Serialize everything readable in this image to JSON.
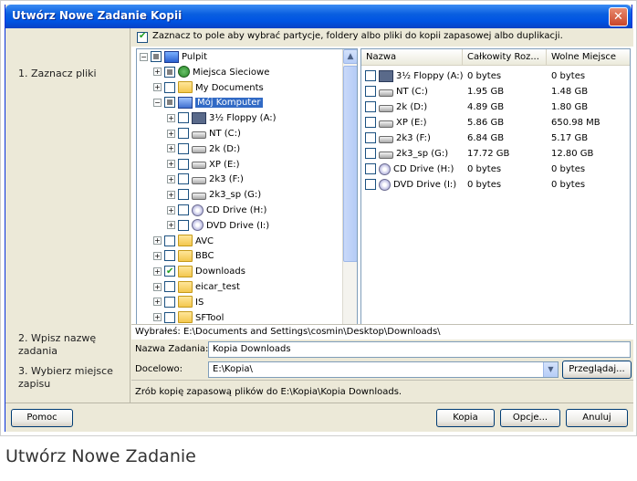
{
  "window": {
    "title": "Utwórz Nowe Zadanie Kopii",
    "close_glyph": "✕"
  },
  "steps": {
    "step1": "1. Zaznacz pliki",
    "step2_line1": "2. Wpisz nazwę",
    "step2_line2": "zadania",
    "step3_line1": "3. Wybierz miejsce",
    "step3_line2": "zapisu"
  },
  "top_checkbox": {
    "checked": true,
    "label": "Zaznacz to pole aby wybrać partycje, foldery albo pliki do kopii zapasowej albo duplikacji."
  },
  "tree": {
    "items": [
      {
        "label": "Pulpit",
        "icon": "desktop-icon",
        "expander": "−",
        "check": "partial"
      },
      {
        "label": "Miejsca Sieciowe",
        "icon": "network-icon",
        "expander": "+",
        "check": "partial"
      },
      {
        "label": "My Documents",
        "icon": "folder-icon",
        "expander": "+",
        "check": "none"
      },
      {
        "label": "Mój Komputer",
        "icon": "computer-icon",
        "expander": "−",
        "check": "partial",
        "selected": true
      },
      {
        "label": "3½ Floppy (A:)",
        "icon": "floppy-icon",
        "expander": "+",
        "check": "none"
      },
      {
        "label": "NT (C:)",
        "icon": "drive-icon",
        "expander": "+",
        "check": "none"
      },
      {
        "label": "2k (D:)",
        "icon": "drive-icon",
        "expander": "+",
        "check": "none"
      },
      {
        "label": "XP (E:)",
        "icon": "drive-icon",
        "expander": "+",
        "check": "none"
      },
      {
        "label": "2k3 (F:)",
        "icon": "drive-icon",
        "expander": "+",
        "check": "none"
      },
      {
        "label": "2k3_sp (G:)",
        "icon": "drive-icon",
        "expander": "+",
        "check": "none"
      },
      {
        "label": "CD Drive (H:)",
        "icon": "cd-icon",
        "expander": "+",
        "check": "none"
      },
      {
        "label": "DVD Drive (I:)",
        "icon": "cd-icon",
        "expander": "+",
        "check": "none"
      },
      {
        "label": "AVC",
        "icon": "folder-icon",
        "expander": "+",
        "check": "none"
      },
      {
        "label": "BBC",
        "icon": "folder-icon",
        "expander": "+",
        "check": "none"
      },
      {
        "label": "Downloads",
        "icon": "folder-icon",
        "expander": "+",
        "check": "checked"
      },
      {
        "label": "eicar_test",
        "icon": "folder-icon",
        "expander": "+",
        "check": "none"
      },
      {
        "label": "IS",
        "icon": "folder-icon",
        "expander": "+",
        "check": "none"
      },
      {
        "label": "SFTool",
        "icon": "folder-icon",
        "expander": "+",
        "check": "none"
      }
    ]
  },
  "list": {
    "headers": [
      "Nazwa",
      "Całkowity Roz...",
      "Wolne Miejsce"
    ],
    "rows": [
      {
        "name": "3½ Floppy (A:)",
        "total": "0 bytes",
        "free": "0 bytes",
        "icon": "floppy-icon"
      },
      {
        "name": "NT (C:)",
        "total": "1.95 GB",
        "free": "1.48 GB",
        "icon": "drive-icon"
      },
      {
        "name": "2k (D:)",
        "total": "4.89 GB",
        "free": "1.80 GB",
        "icon": "drive-icon"
      },
      {
        "name": "XP (E:)",
        "total": "5.86 GB",
        "free": "650.98 MB",
        "icon": "drive-icon"
      },
      {
        "name": "2k3 (F:)",
        "total": "6.84 GB",
        "free": "5.17 GB",
        "icon": "drive-icon"
      },
      {
        "name": "2k3_sp (G:)",
        "total": "17.72 GB",
        "free": "12.80 GB",
        "icon": "drive-icon"
      },
      {
        "name": "CD Drive (H:)",
        "total": "0 bytes",
        "free": "0 bytes",
        "icon": "cd-icon"
      },
      {
        "name": "DVD Drive (I:)",
        "total": "0 bytes",
        "free": "0 bytes",
        "icon": "cd-icon"
      }
    ]
  },
  "selected_path": "Wybrałeś: E:\\Documents and Settings\\cosmin\\Desktop\\Downloads\\",
  "task_name": {
    "label": "Nazwa Zadania:",
    "value": "Kopia Downloads"
  },
  "destination": {
    "label": "Docelowo:",
    "value": "E:\\Kopia\\",
    "browse_label": "Przeglądaj..."
  },
  "info_text": "Zrób kopię zapasową plików do E:\\Kopia\\Kopia Downloads.",
  "buttons": {
    "help": "Pomoc",
    "copy": "Kopia",
    "options": "Opcje...",
    "cancel": "Anuluj"
  },
  "caption": "Utwórz Nowe Zadanie"
}
